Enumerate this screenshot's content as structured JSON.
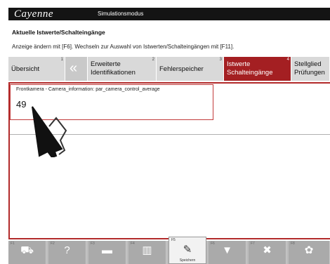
{
  "app": {
    "logo": "Cayenne",
    "mode": "Simulationsmodus"
  },
  "page": {
    "title": "Aktuelle Istwerte/Schalteingänge",
    "hint": "Anzeige ändern mit [F6]. Wechseln zur Auswahl von Istwerten/Schalteingängen mit [F11]."
  },
  "tabs": [
    {
      "line1": "Übersicht",
      "line2": "",
      "num": "1"
    },
    {
      "icon": "back-chevron-icon",
      "glyph": "«"
    },
    {
      "line1": "Erweiterte",
      "line2": "Identifikationen",
      "num": "2"
    },
    {
      "line1": "Fehlerspeicher",
      "line2": "",
      "num": "3"
    },
    {
      "line1": "Istwerte",
      "line2": "Schalteingänge",
      "num": "4",
      "active": true
    },
    {
      "line1": "Stellglied",
      "line2": "Prüfungen",
      "num": ""
    }
  ],
  "card": {
    "label": "Frontkamera - Camera_information: par_camera_control_average",
    "value": "49"
  },
  "toolbar": [
    {
      "icon": "car-icon",
      "glyph": "⛟",
      "fkey": "F1",
      "label": ""
    },
    {
      "icon": "help-icon",
      "glyph": "?",
      "fkey": "F2",
      "label": ""
    },
    {
      "icon": "message-icon",
      "glyph": "▬",
      "fkey": "F3",
      "label": ""
    },
    {
      "icon": "chart-icon",
      "glyph": "▥",
      "fkey": "F4",
      "label": ""
    },
    {
      "icon": "save-icon",
      "glyph": "✎",
      "fkey": "F5",
      "label": "Speichern",
      "active": true
    },
    {
      "icon": "filter-icon",
      "glyph": "▼",
      "fkey": "F6",
      "label": ""
    },
    {
      "icon": "tools-icon",
      "glyph": "✖",
      "fkey": "F7",
      "label": ""
    },
    {
      "icon": "settings-icon",
      "glyph": "✿",
      "fkey": "F8",
      "label": ""
    }
  ],
  "colors": {
    "accent": "#a41f22",
    "titlebar": "#141414",
    "tab": "#d9d9d9",
    "toolbar": "#aaaaaa"
  }
}
